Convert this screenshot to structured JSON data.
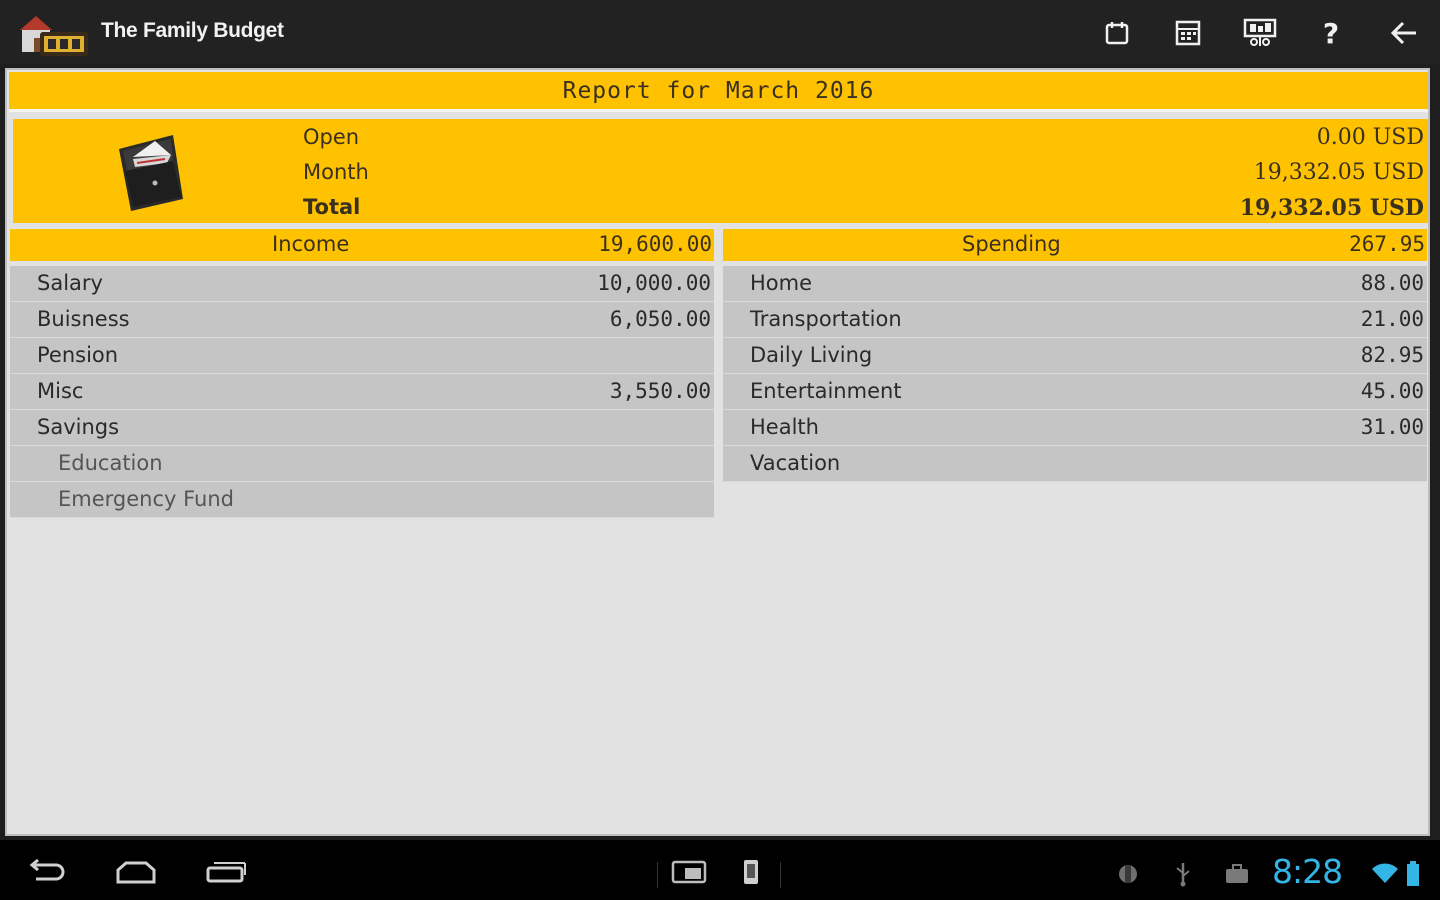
{
  "app": {
    "title": "The Family Budget"
  },
  "report": {
    "title": "Report for March 2016"
  },
  "summary": {
    "open_label": "Open",
    "open_value": "0.00 USD",
    "month_label": "Month",
    "month_value": "19,332.05 USD",
    "total_label": "Total",
    "total_value": "19,332.05 USD"
  },
  "income": {
    "label": "Income",
    "total": "19,600.00",
    "items": [
      {
        "label": "Salary",
        "value": "10,000.00"
      },
      {
        "label": "Buisness",
        "value": "6,050.00"
      },
      {
        "label": "Pension",
        "value": ""
      },
      {
        "label": "Misc",
        "value": "3,550.00"
      },
      {
        "label": "Savings",
        "value": ""
      },
      {
        "label": "Education",
        "value": ""
      },
      {
        "label": "Emergency Fund",
        "value": ""
      }
    ]
  },
  "spending": {
    "label": "Spending",
    "total": "267.95",
    "items": [
      {
        "label": "Home",
        "value": "88.00"
      },
      {
        "label": "Transportation",
        "value": "21.00"
      },
      {
        "label": "Daily Living",
        "value": "82.95"
      },
      {
        "label": "Entertainment",
        "value": "45.00"
      },
      {
        "label": "Health",
        "value": "31.00"
      },
      {
        "label": "Vacation",
        "value": ""
      }
    ]
  },
  "status": {
    "time": "8:28"
  },
  "colors": {
    "accent": "#ffc200",
    "row": "#c5c5c5",
    "clock": "#33b5e5"
  },
  "icons": [
    "calendar-icon",
    "calendar-grid-icon",
    "presentation-icon",
    "help-icon",
    "back-arrow-icon"
  ]
}
